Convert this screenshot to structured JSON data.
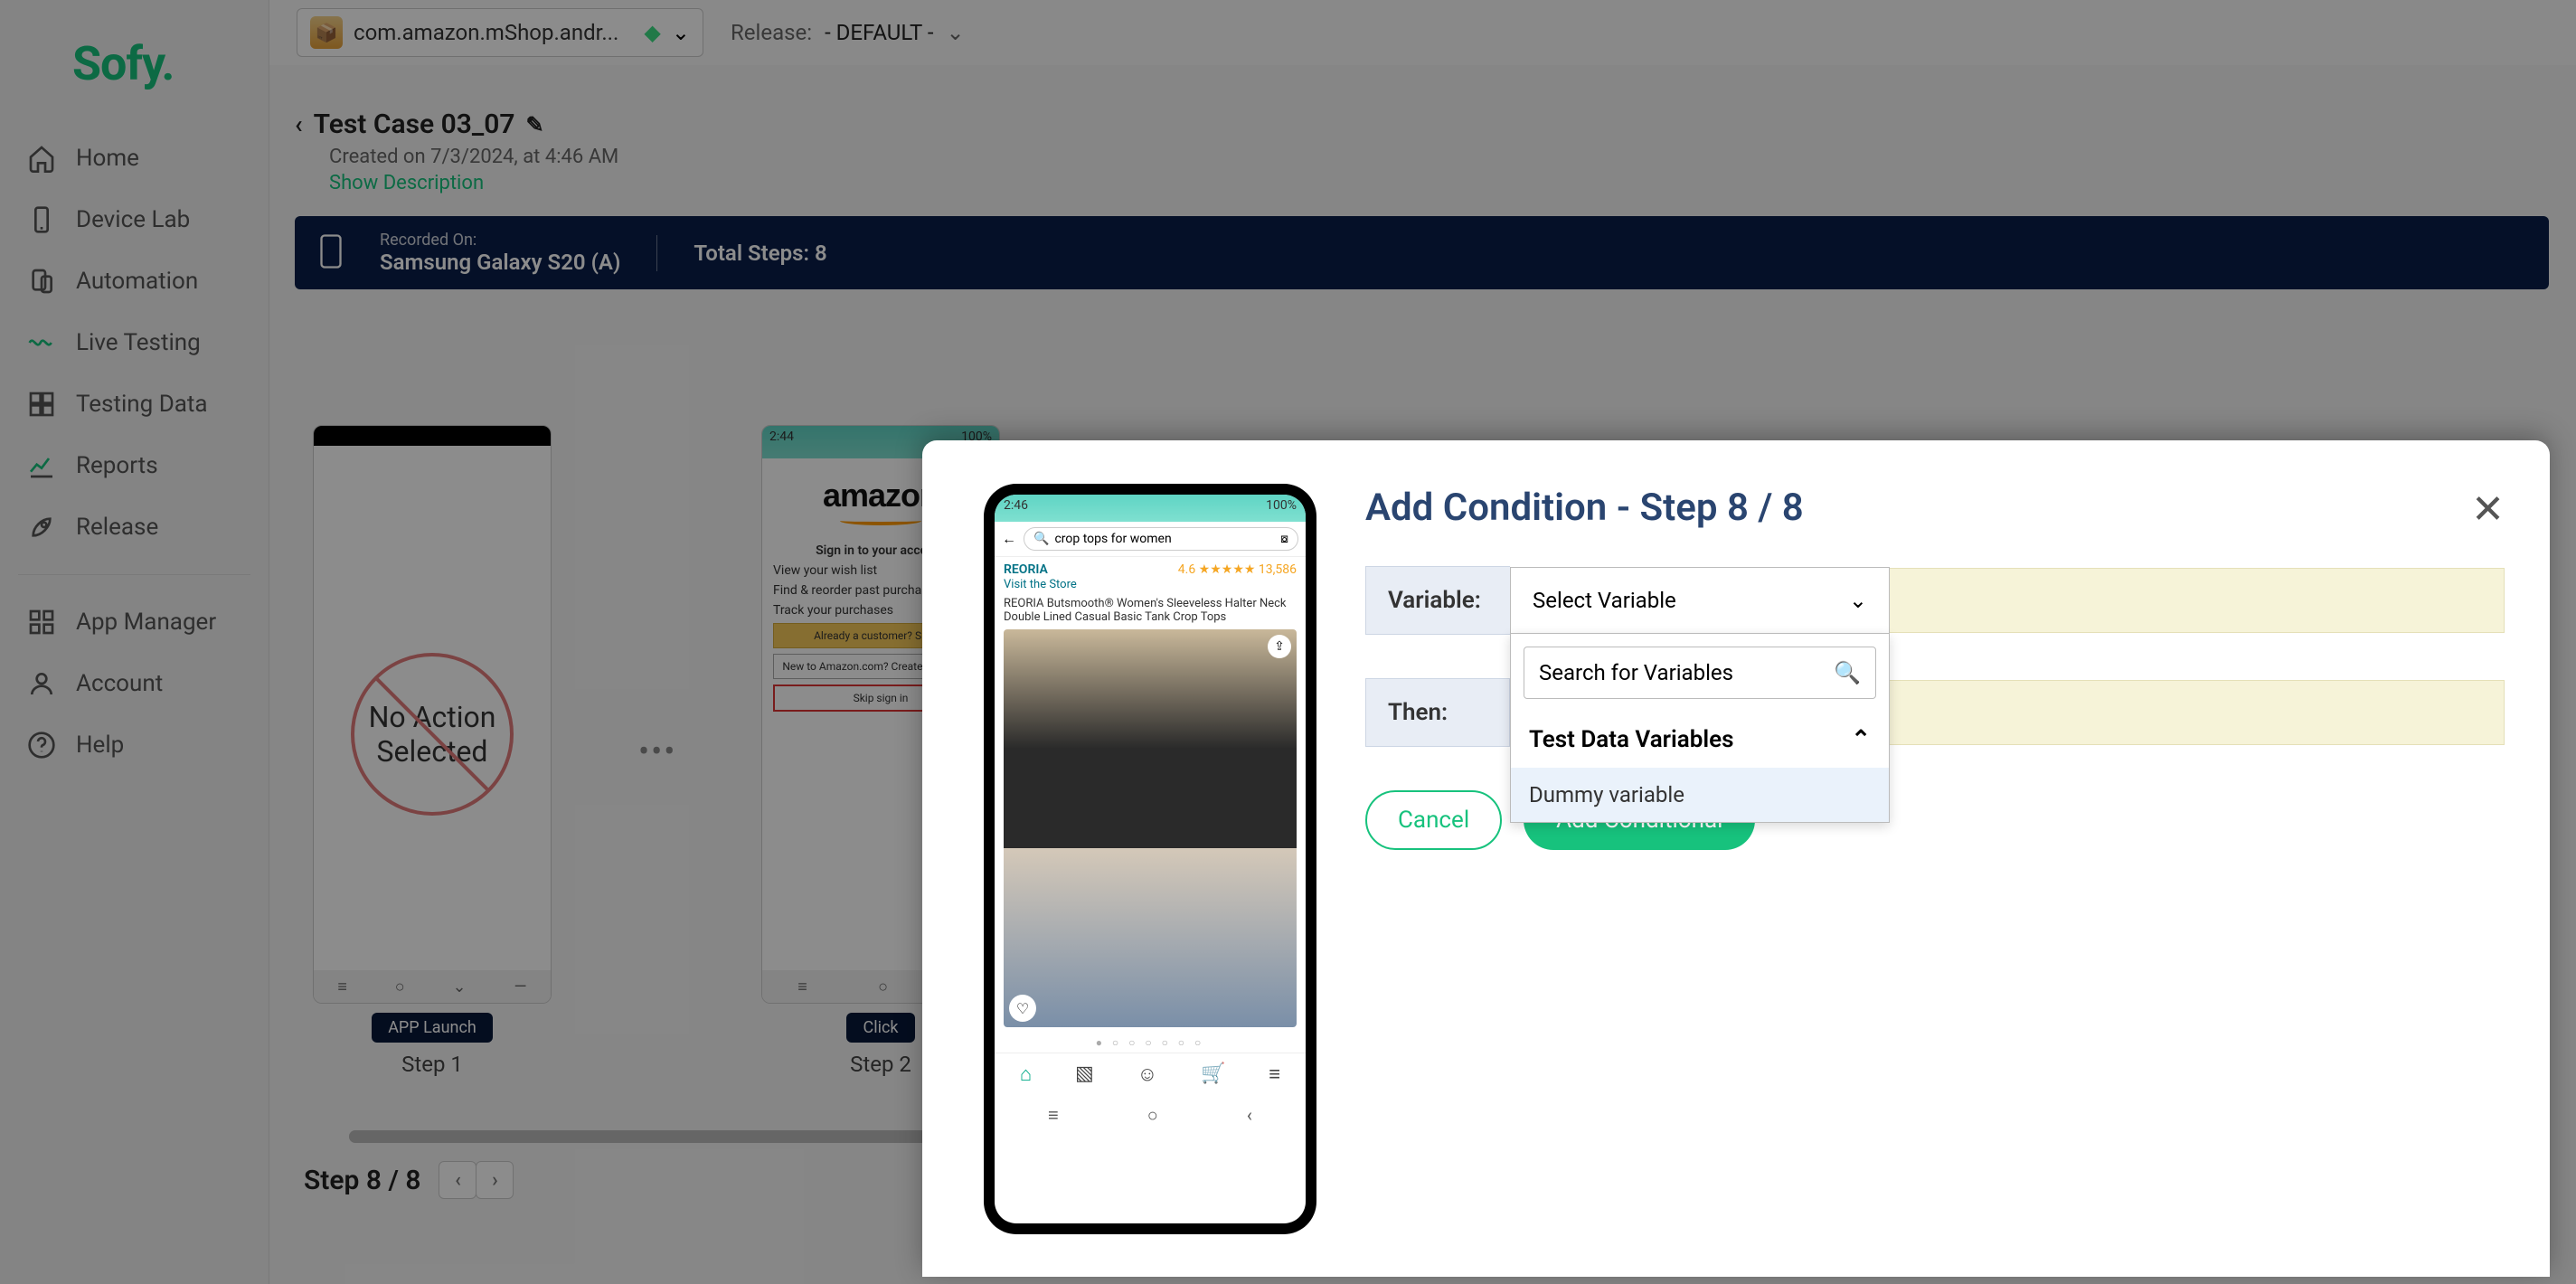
{
  "brand": "Sofy.",
  "topbar": {
    "app_name": "com.amazon.mShop.andr...",
    "release_label": "Release:",
    "release_value": "- DEFAULT -"
  },
  "sidebar": {
    "items": [
      {
        "label": "Home"
      },
      {
        "label": "Device Lab"
      },
      {
        "label": "Automation"
      },
      {
        "label": "Live Testing"
      },
      {
        "label": "Testing Data"
      },
      {
        "label": "Reports"
      },
      {
        "label": "Release"
      }
    ],
    "secondary": [
      {
        "label": "App Manager"
      },
      {
        "label": "Account"
      },
      {
        "label": "Help"
      }
    ]
  },
  "testcase": {
    "title": "Test Case 03_07",
    "created": "Created on 7/3/2024, at 4:46 AM",
    "show_description": "Show Description",
    "recorded_label": "Recorded On:",
    "recorded_device": "Samsung Galaxy S20 (A)",
    "total_steps": "Total Steps: 8",
    "footer": "Step 8 / 8"
  },
  "steps": {
    "no_action": "No Action Selected",
    "step1_badge": "APP Launch",
    "step1_label": "Step 1",
    "step2_badge": "Click",
    "step2_label": "Step 2",
    "amazon": {
      "logo": "amazon",
      "signin": "Sign in to your account",
      "l1": "View your wish list",
      "l2": "Find & reorder past purchases",
      "l3": "Track your purchases",
      "b1": "Already a customer? Sign in",
      "b2": "New to Amazon.com? Create an account",
      "b3": "Skip sign in"
    },
    "phone_status_left": "2:44",
    "phone_status_right": "100%"
  },
  "modal": {
    "title": "Add Condition - Step 8 / 8",
    "variable_label": "Variable:",
    "select_placeholder": "Select Variable",
    "then_label": "Then:",
    "cancel": "Cancel",
    "add": "Add Conditional",
    "dropdown": {
      "search_placeholder": "Search for Variables",
      "section": "Test Data Variables",
      "option1": "Dummy variable"
    },
    "phone": {
      "status_left": "2:46",
      "status_right": "100%",
      "search": "crop tops for women",
      "brand": "REORIA",
      "store": "Visit the Store",
      "rating": "4.6 ★★★★★ 13,586",
      "title": "REORIA Butsmooth® Women's Sleeveless Halter Neck Double Lined Casual Basic Tank Crop Tops"
    }
  }
}
